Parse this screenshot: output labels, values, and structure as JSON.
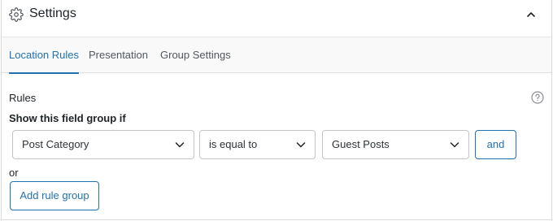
{
  "header": {
    "title": "Settings",
    "icon": "gear-icon",
    "collapse_icon": "chevron-up-icon"
  },
  "tabs": [
    {
      "label": "Location Rules",
      "active": true
    },
    {
      "label": "Presentation",
      "active": false
    },
    {
      "label": "Group Settings",
      "active": false
    }
  ],
  "rules": {
    "section_label": "Rules",
    "help_icon": "help-icon",
    "condition_label": "Show this field group if",
    "rule": {
      "param": "Post Category",
      "operator": "is equal to",
      "value": "Guest Posts"
    },
    "and_label": "and",
    "or_label": "or",
    "add_group_label": "Add rule group"
  },
  "colors": {
    "accent": "#2271b1",
    "border": "#c3c4c7",
    "text": "#1d2327",
    "muted": "#50575e"
  }
}
